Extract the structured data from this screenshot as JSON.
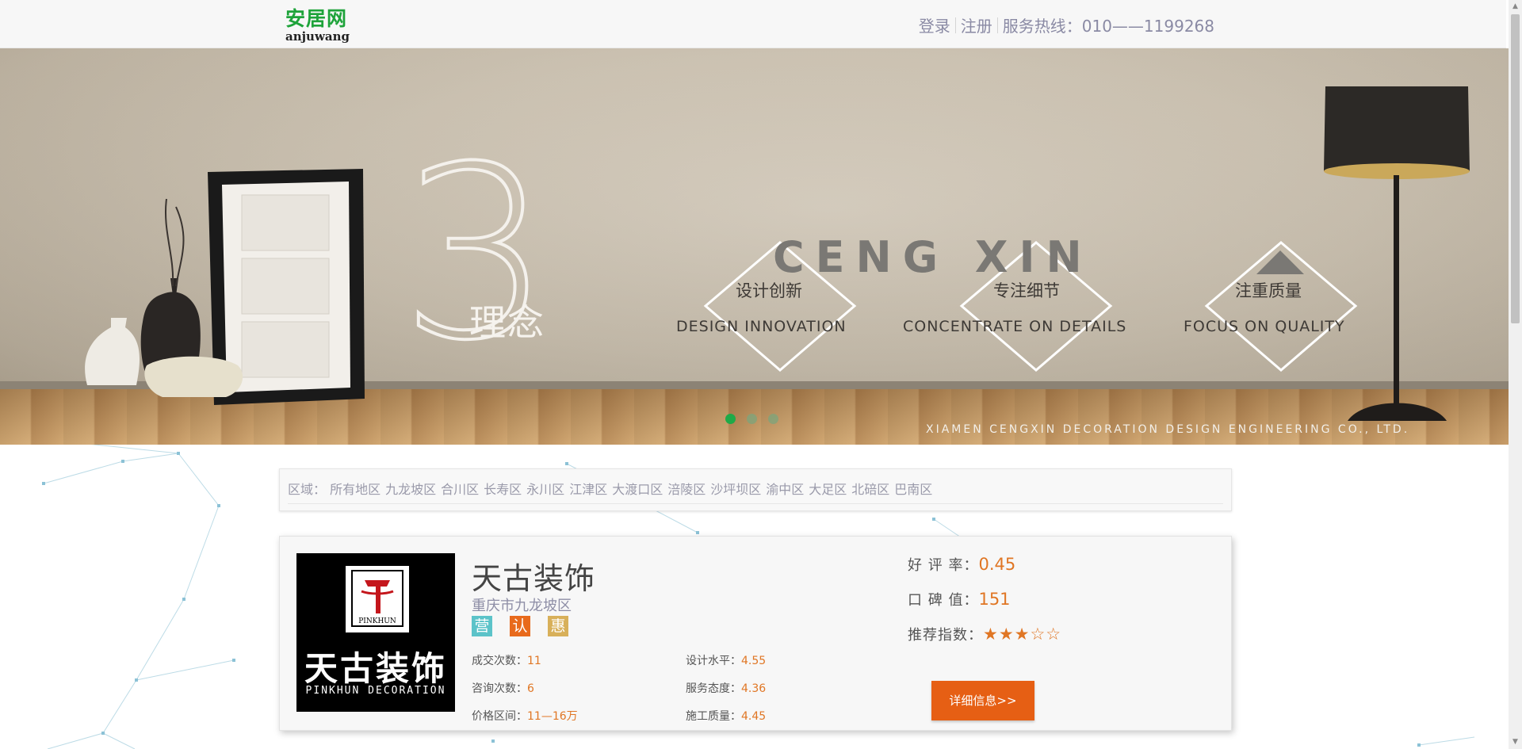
{
  "header": {
    "logo_cn": "安居网",
    "logo_en": "anjuwang",
    "login": "登录",
    "register": "注册",
    "hotline": "服务热线：010——1199268"
  },
  "banner": {
    "big_number": "3",
    "concept": "理念",
    "brand": "CENG XIN",
    "pillars": [
      {
        "cn": "设计创新",
        "en": "DESIGN INNOVATION"
      },
      {
        "cn": "专注细节",
        "en": "CONCENTRATE ON DETAILS"
      },
      {
        "cn": "注重质量",
        "en": "FOCUS ON QUALITY"
      }
    ],
    "company": "XIAMEN  CENGXIN DECORATION DESIGN ENGINEERING CO., LTD.",
    "carousel": {
      "count": 3,
      "active": 1
    }
  },
  "region": {
    "label": "区域：",
    "items": [
      "所有地区",
      "九龙坡区",
      "合川区",
      "长寿区",
      "永川区",
      "江津区",
      "大渡口区",
      "涪陵区",
      "沙坪坝区",
      "渝中区",
      "大足区",
      "北碚区",
      "巴南区"
    ]
  },
  "company_card": {
    "logo_cn": "天古装饰",
    "logo_en": "PINKHUN DECORATION",
    "logo_mark": "PINKHUN",
    "name": "天古装饰",
    "district": "重庆市九龙坡区",
    "badges": [
      {
        "text": "营",
        "color": "#5cc3c9"
      },
      {
        "text": "认",
        "color": "#e86a1c"
      },
      {
        "text": "惠",
        "color": "#d8b05a"
      }
    ],
    "stats": {
      "deals_label": "成交次数：",
      "deals": "11",
      "consults_label": "咨询次数：",
      "consults": "6",
      "price_label": "价格区间：",
      "price": "11—16万",
      "design_label": "设计水平：",
      "design": "4.55",
      "service_label": "服务态度：",
      "service": "4.36",
      "quality_label": "施工质量：",
      "quality": "4.45"
    },
    "rating_label": "好 评 率：",
    "rating": "0.45",
    "reputation_label": "口 碑 值：",
    "reputation": "151",
    "recommend_label": "推荐指数：",
    "recommend_stars": "★★★☆☆",
    "recommend_value": 3,
    "detail_button": "详细信息>>"
  }
}
